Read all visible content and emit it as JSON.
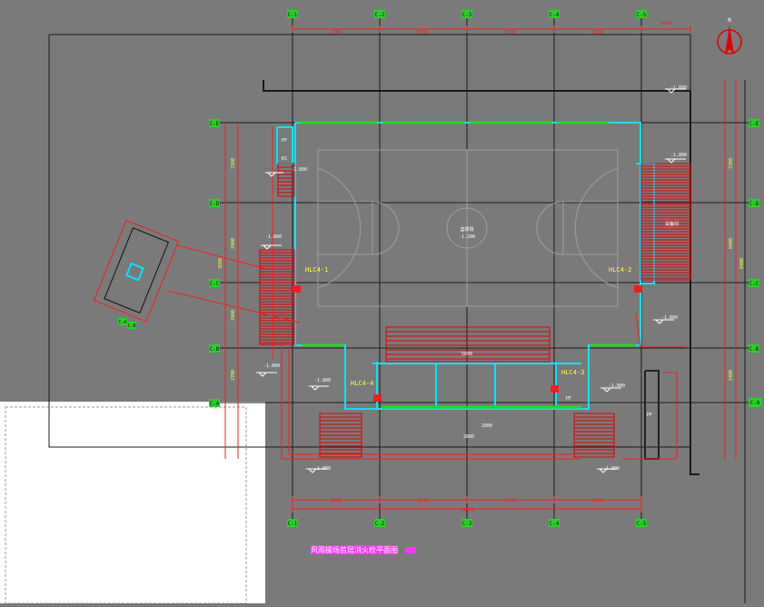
{
  "colors": {
    "background": "#7a7a7a",
    "paper": "#ffffff",
    "grid_line": "#1a1a1a",
    "dimension": "#ff1a1a",
    "wall": "#00e5ff",
    "opening": "#22d622",
    "tag": "#ffff33",
    "title_fill": "#ff33ff",
    "hatch": "#e00000"
  },
  "grid_top": [
    "C-1",
    "C-2",
    "C-3",
    "C-4",
    "C-5"
  ],
  "grid_side": [
    "C-A",
    "C-B",
    "C-C",
    "C-D",
    "C-E"
  ],
  "grid_extra": "C-A",
  "dims_top": [
    "8700",
    "8700",
    "8700",
    "8700",
    "4800"
  ],
  "dims_bottom": [
    "8700",
    "8700",
    "8700",
    "8700"
  ],
  "dims_bottom_total": "34800",
  "dims_left": [
    "7200",
    "2400",
    "3600",
    "2400",
    "2700"
  ],
  "dims_right": [
    "7200",
    "8400",
    "8400",
    "2400"
  ],
  "hydrants": [
    {
      "id": "hydrant-1",
      "label": "HLC4-1"
    },
    {
      "id": "hydrant-2",
      "label": "HLC4-2"
    },
    {
      "id": "hydrant-3",
      "label": "HLC4-3"
    },
    {
      "id": "hydrant-4",
      "label": "HLC4-4"
    }
  ],
  "levels": [
    "-1.800",
    "-1.800",
    "-1.800",
    "-1.800",
    "-1.800",
    "-1.800",
    "-1.800",
    "-1.800",
    "-1.800",
    "-1.800"
  ],
  "court_label": [
    "篮球场",
    "-1.200"
  ],
  "room_labels": [
    "PF",
    "KS",
    "PF",
    "设备间",
    "PF"
  ],
  "drawing_title": "风雨操场首层消火栓平面图",
  "compass_label": "N",
  "small_text": [
    "5000",
    "2800",
    "2800"
  ]
}
